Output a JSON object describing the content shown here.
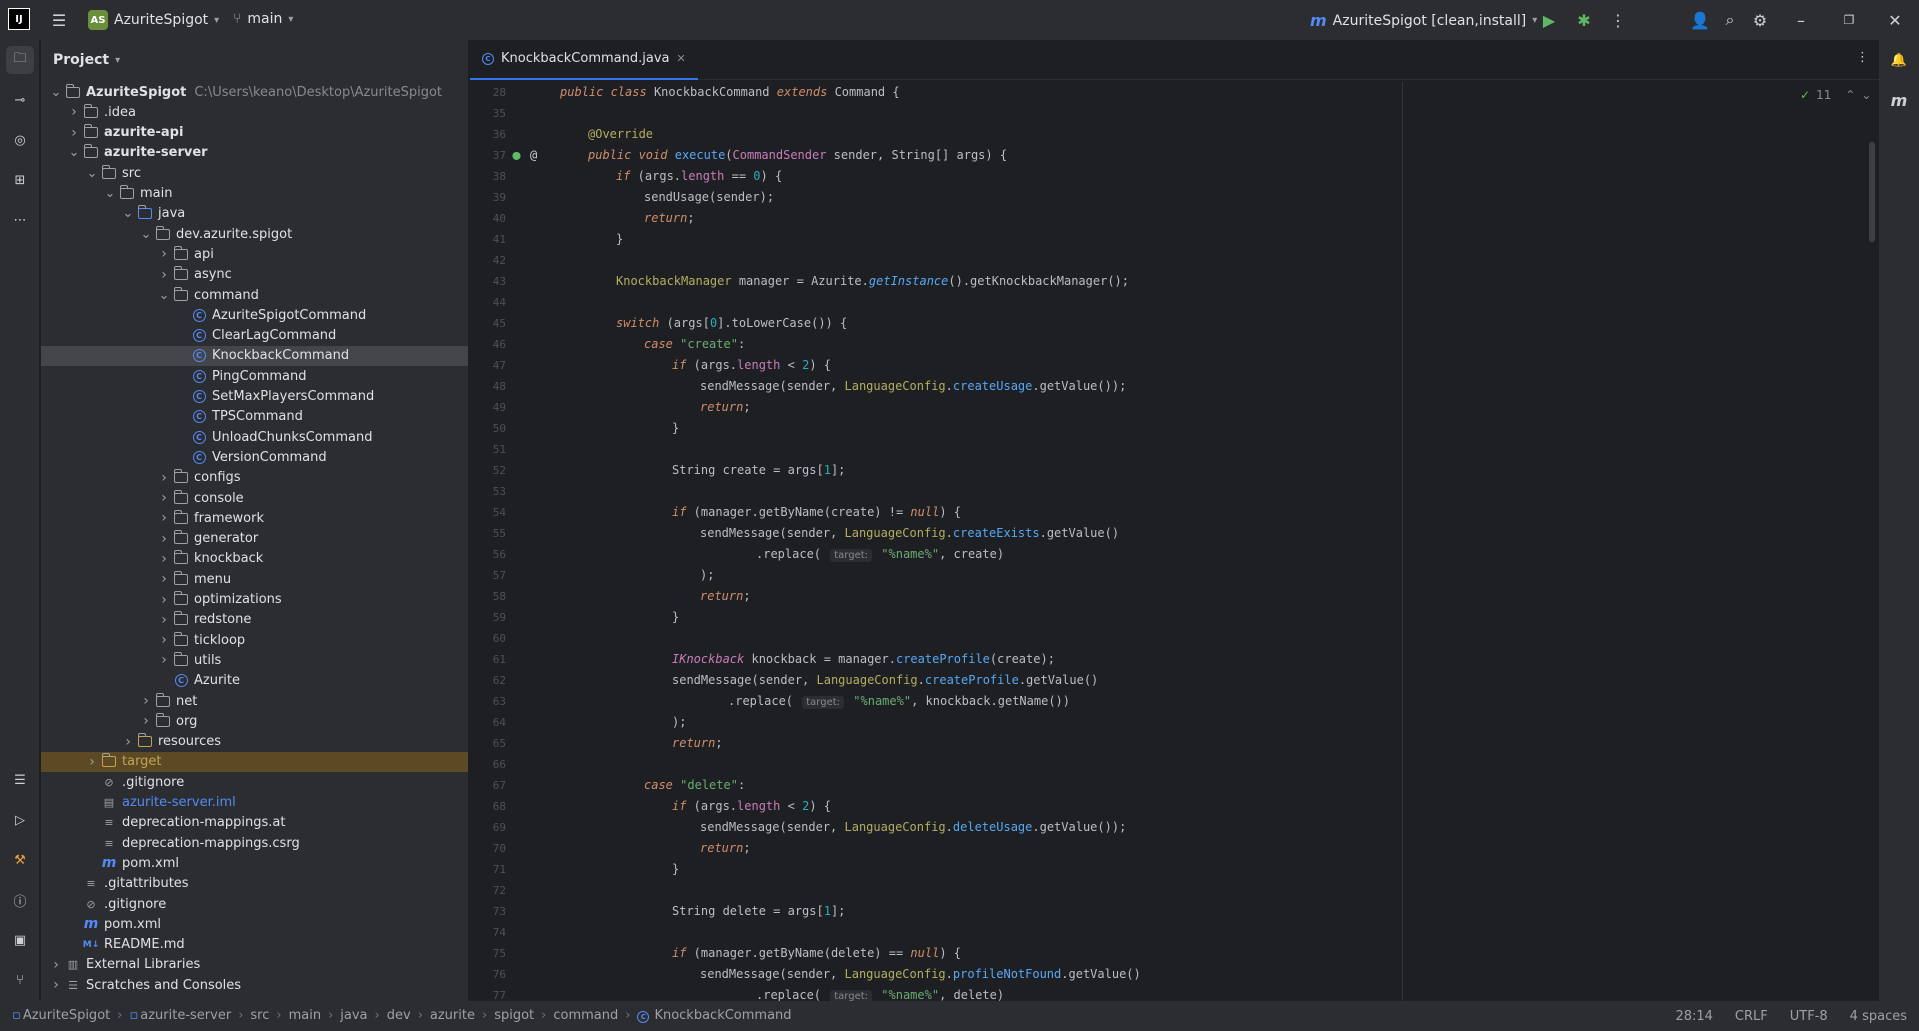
{
  "titlebar": {
    "project_badge": "AS",
    "project_name": "AzuriteSpigot",
    "branch": "main",
    "run_config": "AzuriteSpigot [clean,install]"
  },
  "project_panel": {
    "title": "Project",
    "tree": [
      {
        "label": "AzuriteSpigot",
        "path": "C:\\Users\\keano\\Desktop\\AzuriteSpigot",
        "depth": 0,
        "arrow": "open",
        "icon": "module",
        "bold": true
      },
      {
        "label": ".idea",
        "depth": 1,
        "arrow": "closed",
        "icon": "folder"
      },
      {
        "label": "azurite-api",
        "depth": 1,
        "arrow": "closed",
        "icon": "module",
        "bold": true
      },
      {
        "label": "azurite-server",
        "depth": 1,
        "arrow": "open",
        "icon": "module",
        "bold": true
      },
      {
        "label": "src",
        "depth": 2,
        "arrow": "open",
        "icon": "folder"
      },
      {
        "label": "main",
        "depth": 3,
        "arrow": "open",
        "icon": "folder"
      },
      {
        "label": "java",
        "depth": 4,
        "arrow": "open",
        "icon": "folder-src"
      },
      {
        "label": "dev.azurite.spigot",
        "depth": 5,
        "arrow": "open",
        "icon": "package"
      },
      {
        "label": "api",
        "depth": 6,
        "arrow": "closed",
        "icon": "package"
      },
      {
        "label": "async",
        "depth": 6,
        "arrow": "closed",
        "icon": "package"
      },
      {
        "label": "command",
        "depth": 6,
        "arrow": "open",
        "icon": "package"
      },
      {
        "label": "AzuriteSpigotCommand",
        "depth": 7,
        "arrow": "none",
        "icon": "class"
      },
      {
        "label": "ClearLagCommand",
        "depth": 7,
        "arrow": "none",
        "icon": "class"
      },
      {
        "label": "KnockbackCommand",
        "depth": 7,
        "arrow": "none",
        "icon": "class",
        "selected": true
      },
      {
        "label": "PingCommand",
        "depth": 7,
        "arrow": "none",
        "icon": "class"
      },
      {
        "label": "SetMaxPlayersCommand",
        "depth": 7,
        "arrow": "none",
        "icon": "class"
      },
      {
        "label": "TPSCommand",
        "depth": 7,
        "arrow": "none",
        "icon": "class"
      },
      {
        "label": "UnloadChunksCommand",
        "depth": 7,
        "arrow": "none",
        "icon": "class"
      },
      {
        "label": "VersionCommand",
        "depth": 7,
        "arrow": "none",
        "icon": "class"
      },
      {
        "label": "configs",
        "depth": 6,
        "arrow": "closed",
        "icon": "package"
      },
      {
        "label": "console",
        "depth": 6,
        "arrow": "closed",
        "icon": "package"
      },
      {
        "label": "framework",
        "depth": 6,
        "arrow": "closed",
        "icon": "package"
      },
      {
        "label": "generator",
        "depth": 6,
        "arrow": "closed",
        "icon": "package"
      },
      {
        "label": "knockback",
        "depth": 6,
        "arrow": "closed",
        "icon": "package"
      },
      {
        "label": "menu",
        "depth": 6,
        "arrow": "closed",
        "icon": "package"
      },
      {
        "label": "optimizations",
        "depth": 6,
        "arrow": "closed",
        "icon": "package"
      },
      {
        "label": "redstone",
        "depth": 6,
        "arrow": "closed",
        "icon": "package"
      },
      {
        "label": "tickloop",
        "depth": 6,
        "arrow": "closed",
        "icon": "package"
      },
      {
        "label": "utils",
        "depth": 6,
        "arrow": "closed",
        "icon": "package"
      },
      {
        "label": "Azurite",
        "depth": 6,
        "arrow": "none",
        "icon": "class"
      },
      {
        "label": "net",
        "depth": 5,
        "arrow": "closed",
        "icon": "package"
      },
      {
        "label": "org",
        "depth": 5,
        "arrow": "closed",
        "icon": "package"
      },
      {
        "label": "resources",
        "depth": 4,
        "arrow": "closed",
        "icon": "folder-res"
      },
      {
        "label": "target",
        "depth": 2,
        "arrow": "closed",
        "icon": "folder-excluded",
        "excluded": true
      },
      {
        "label": ".gitignore",
        "depth": 2,
        "arrow": "none",
        "icon": "ignore"
      },
      {
        "label": "azurite-server.iml",
        "depth": 2,
        "arrow": "none",
        "icon": "file",
        "dim": true
      },
      {
        "label": "deprecation-mappings.at",
        "depth": 2,
        "arrow": "none",
        "icon": "text"
      },
      {
        "label": "deprecation-mappings.csrg",
        "depth": 2,
        "arrow": "none",
        "icon": "text"
      },
      {
        "label": "pom.xml",
        "depth": 2,
        "arrow": "none",
        "icon": "maven"
      },
      {
        "label": ".gitattributes",
        "depth": 1,
        "arrow": "none",
        "icon": "text"
      },
      {
        "label": ".gitignore",
        "depth": 1,
        "arrow": "none",
        "icon": "ignore"
      },
      {
        "label": "pom.xml",
        "depth": 1,
        "arrow": "none",
        "icon": "maven"
      },
      {
        "label": "README.md",
        "depth": 1,
        "arrow": "none",
        "icon": "markdown"
      },
      {
        "label": "External Libraries",
        "depth": 0,
        "arrow": "closed",
        "icon": "library"
      },
      {
        "label": "Scratches and Consoles",
        "depth": 0,
        "arrow": "closed",
        "icon": "scratch"
      }
    ]
  },
  "editor": {
    "tab_label": "KnockbackCommand.java",
    "inspection_count": "11",
    "lines": [
      {
        "n": "28",
        "html": "<span class='kwi'>public class</span> <span class='cls'>KnockbackCommand</span> <span class='kwi'>extends</span> <span class='cls'>Command</span> {",
        "indent": 0
      },
      {
        "n": "35",
        "html": "",
        "indent": 0
      },
      {
        "n": "36",
        "html": "<span class='ann'>@Override</span>",
        "indent": 1
      },
      {
        "n": "37",
        "html": "<span class='kwi'>public void</span> <span class='mth'>execute</span>(<span class='itf'>CommandSender</span> sender, String[] args) {",
        "indent": 1,
        "gutter": true
      },
      {
        "n": "38",
        "html": "<span class='kwi'>if</span> (args.<span class='fld'>length</span> == <span class='num'>0</span>) {",
        "indent": 2
      },
      {
        "n": "39",
        "html": "sendUsage(sender);",
        "indent": 3
      },
      {
        "n": "40",
        "html": "<span class='kwi'>return</span>;",
        "indent": 3
      },
      {
        "n": "41",
        "html": "}",
        "indent": 2
      },
      {
        "n": "42",
        "html": "",
        "indent": 0
      },
      {
        "n": "43",
        "html": "<span class='ann'>KnockbackManager</span> manager = <span class='cls'>Azurite</span>.<span class='stm'>getInstance</span>().getKnockbackManager();",
        "indent": 2
      },
      {
        "n": "44",
        "html": "",
        "indent": 0
      },
      {
        "n": "45",
        "html": "<span class='kwi'>switch</span> (args[<span class='num'>0</span>].toLowerCase()) {",
        "indent": 2
      },
      {
        "n": "46",
        "html": "<span class='kwi'>case</span> <span class='str'>\"create\"</span>:",
        "indent": 3
      },
      {
        "n": "47",
        "html": "<span class='kwi'>if</span> (args.<span class='fld'>length</span> &lt; <span class='num'>2</span>) {",
        "indent": 4
      },
      {
        "n": "48",
        "html": "sendMessage(sender, <span class='ann'>LanguageConfig</span>.<span class='mth'>createUsage</span>.getValue());",
        "indent": 5
      },
      {
        "n": "49",
        "html": "<span class='kwi'>return</span>;",
        "indent": 5
      },
      {
        "n": "50",
        "html": "}",
        "indent": 4
      },
      {
        "n": "51",
        "html": "",
        "indent": 0
      },
      {
        "n": "52",
        "html": "String create = args[<span class='num'>1</span>];",
        "indent": 4
      },
      {
        "n": "53",
        "html": "",
        "indent": 0
      },
      {
        "n": "54",
        "html": "<span class='kwi'>if</span> (manager.getByName(create) != <span class='kwi'>null</span>) {",
        "indent": 4
      },
      {
        "n": "55",
        "html": "sendMessage(sender, <span class='ann'>LanguageConfig</span>.<span class='mth'>createExists</span>.getValue()",
        "indent": 5
      },
      {
        "n": "56",
        "html": ".replace( <span class='hint'>target:</span> <span class='str'>\"%name%\"</span>, create)",
        "indent": 7
      },
      {
        "n": "57",
        "html": ");",
        "indent": 5
      },
      {
        "n": "58",
        "html": "<span class='kwi'>return</span>;",
        "indent": 5
      },
      {
        "n": "59",
        "html": "}",
        "indent": 4
      },
      {
        "n": "60",
        "html": "",
        "indent": 0
      },
      {
        "n": "61",
        "html": "<span class='itf' style='font-style:italic'>IKnockback</span> knockback = manager.<span class='mth'>createProfile</span>(create);",
        "indent": 4
      },
      {
        "n": "62",
        "html": "sendMessage(sender, <span class='ann'>LanguageConfig</span>.<span class='mth'>createProfile</span>.getValue()",
        "indent": 4
      },
      {
        "n": "63",
        "html": ".replace( <span class='hint'>target:</span> <span class='str'>\"%name%\"</span>, knockback.getName())",
        "indent": 6
      },
      {
        "n": "64",
        "html": ");",
        "indent": 4
      },
      {
        "n": "65",
        "html": "<span class='kwi'>return</span>;",
        "indent": 4
      },
      {
        "n": "66",
        "html": "",
        "indent": 0
      },
      {
        "n": "67",
        "html": "<span class='kwi'>case</span> <span class='str'>\"delete\"</span>:",
        "indent": 3
      },
      {
        "n": "68",
        "html": "<span class='kwi'>if</span> (args.<span class='fld'>length</span> &lt; <span class='num'>2</span>) {",
        "indent": 4
      },
      {
        "n": "69",
        "html": "sendMessage(sender, <span class='ann'>LanguageConfig</span>.<span class='mth'>deleteUsage</span>.getValue());",
        "indent": 5
      },
      {
        "n": "70",
        "html": "<span class='kwi'>return</span>;",
        "indent": 5
      },
      {
        "n": "71",
        "html": "}",
        "indent": 4
      },
      {
        "n": "72",
        "html": "",
        "indent": 0
      },
      {
        "n": "73",
        "html": "String delete = args[<span class='num'>1</span>];",
        "indent": 4
      },
      {
        "n": "74",
        "html": "",
        "indent": 0
      },
      {
        "n": "75",
        "html": "<span class='kwi'>if</span> (manager.getByName(delete) == <span class='kwi'>null</span>) {",
        "indent": 4
      },
      {
        "n": "76",
        "html": "sendMessage(sender, <span class='ann'>LanguageConfig</span>.<span class='mth'>profileNotFound</span>.getValue()",
        "indent": 5
      },
      {
        "n": "77",
        "html": ".replace( <span class='hint'>target:</span> <span class='str'>\"%name%\"</span>, delete)",
        "indent": 7
      }
    ]
  },
  "statusbar": {
    "breadcrumbs": [
      "AzuriteSpigot",
      "azurite-server",
      "src",
      "main",
      "java",
      "dev",
      "azurite",
      "spigot",
      "command",
      "KnockbackCommand"
    ],
    "cursor": "28:14",
    "line_sep": "CRLF",
    "encoding": "UTF-8",
    "indent": "4 spaces"
  },
  "colors": {
    "accent": "#3574f0",
    "bg": "#1e1f22",
    "panel": "#2b2d30"
  }
}
